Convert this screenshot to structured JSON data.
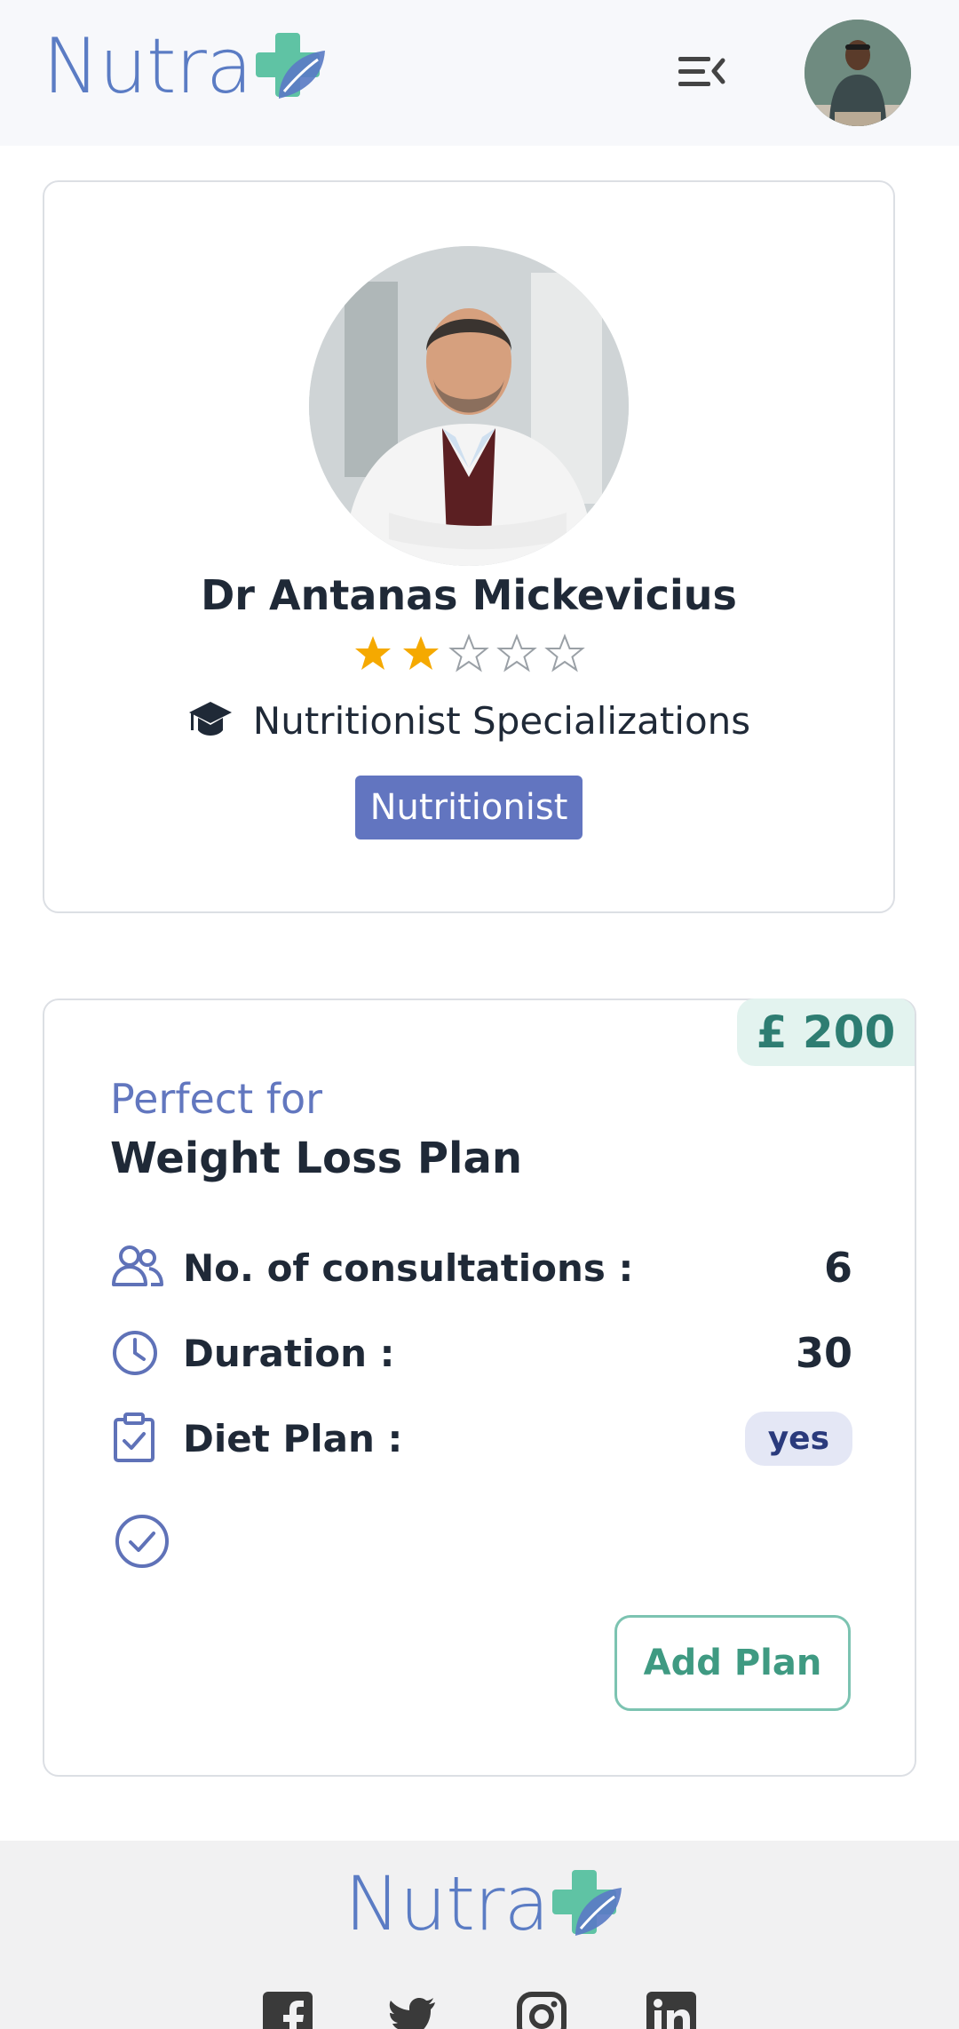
{
  "header": {
    "logo_text": "Nutra"
  },
  "doctor": {
    "name": "Dr Antanas Mickevicius",
    "rating": 2,
    "rating_max": 5,
    "specialization_label": "Nutritionist Specializations",
    "badge": "Nutritionist"
  },
  "plan": {
    "price": "£ 200",
    "perfect_for": "Perfect for",
    "name": "Weight Loss Plan",
    "consultations_label": "No. of consultations :",
    "consultations_value": "6",
    "duration_label": "Duration :",
    "duration_value": "30",
    "diet_label": "Diet Plan :",
    "diet_value": "yes",
    "add_button": "Add Plan"
  },
  "footer": {
    "logo_text": "Nutra",
    "social": [
      "facebook-icon",
      "twitter-icon",
      "instagram-icon",
      "linkedin-icon"
    ]
  },
  "colors": {
    "accent": "#5b7cc4",
    "badge": "#6275c0",
    "price_text": "#2e7d72",
    "button_border": "#7cc3b1",
    "star": "#f5a900"
  }
}
